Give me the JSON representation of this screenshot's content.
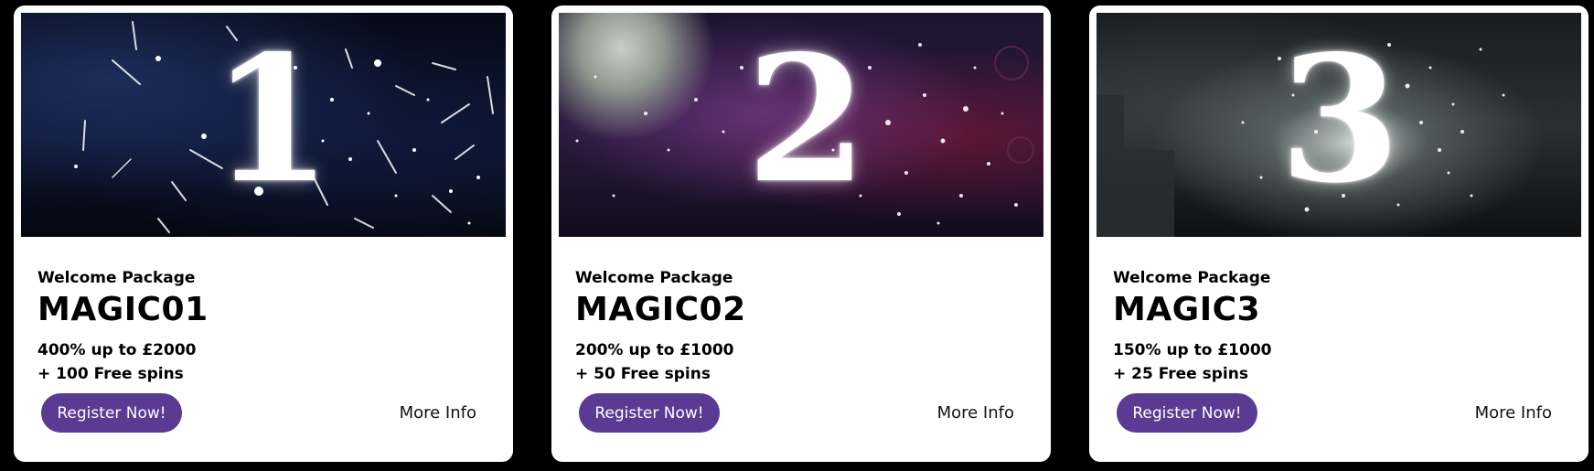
{
  "colors": {
    "page_background": "#000000",
    "card_background": "#ffffff",
    "button_background": "#5b3a94",
    "button_text": "#ffffff"
  },
  "cards": [
    {
      "banner_number": "1",
      "eyebrow": "Welcome Package",
      "code": "MAGIC01",
      "offer_line1": "400% up to £2000",
      "offer_line2": "+ 100 Free spins",
      "register_label": "Register Now!",
      "more_info_label": "More Info"
    },
    {
      "banner_number": "2",
      "eyebrow": "Welcome Package",
      "code": "MAGIC02",
      "offer_line1": "200% up to £1000",
      "offer_line2": "+ 50 Free spins",
      "register_label": "Register Now!",
      "more_info_label": "More Info"
    },
    {
      "banner_number": "3",
      "eyebrow": "Welcome Package",
      "code": "MAGIC3",
      "offer_line1": "150% up to £1000",
      "offer_line2": "+ 25 Free spins",
      "register_label": "Register Now!",
      "more_info_label": "More Info"
    }
  ]
}
